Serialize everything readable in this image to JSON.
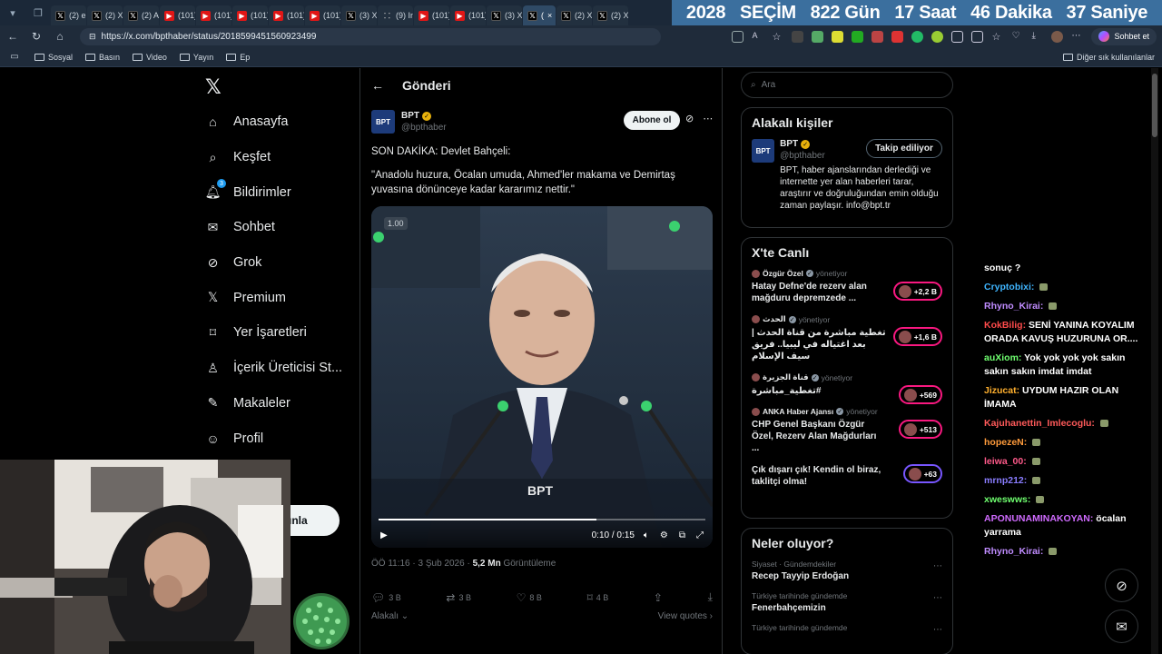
{
  "browser": {
    "tabs": [
      {
        "label": "(2) er",
        "icon": "x-icon"
      },
      {
        "label": "(2) X",
        "icon": "x-icon"
      },
      {
        "label": "(2) A",
        "icon": "x-icon"
      },
      {
        "label": "(101)",
        "icon": "youtube-icon"
      },
      {
        "label": "(101)",
        "icon": "youtube-icon"
      },
      {
        "label": "(101)",
        "icon": "youtube-icon"
      },
      {
        "label": "(101)",
        "icon": "youtube-icon"
      },
      {
        "label": "(101)",
        "icon": "youtube-icon"
      },
      {
        "label": "(3) X",
        "icon": "x-icon"
      },
      {
        "label": "(9) In",
        "icon": "grid-icon"
      },
      {
        "label": "(101)",
        "icon": "youtube-icon"
      },
      {
        "label": "(101)",
        "icon": "youtube-icon"
      },
      {
        "label": "(3) X",
        "icon": "x-icon"
      },
      {
        "label": "(",
        "icon": "x-icon",
        "active": true
      },
      {
        "label": "(2) X",
        "icon": "x-icon"
      },
      {
        "label": "(2) X",
        "icon": "x-icon"
      }
    ],
    "countdown": {
      "year": "2028",
      "label": "SEÇİM",
      "days": "822 Gün",
      "hours": "17 Saat",
      "minutes": "46 Dakika",
      "seconds": "37 Saniye"
    },
    "url": "https://x.com/bpthaber/status/2018599451560923499",
    "copilot_label": "Sohbet et",
    "bookmarks": [
      "Sosyal",
      "Basın",
      "Video",
      "Yayın",
      "Ep"
    ],
    "other_bookmarks": "Diğer sık kullanılanlar"
  },
  "nav": {
    "items": [
      {
        "label": "Anasayfa",
        "icon": "home-icon"
      },
      {
        "label": "Keşfet",
        "icon": "search-icon"
      },
      {
        "label": "Bildirimler",
        "icon": "bell-icon",
        "badge": "3"
      },
      {
        "label": "Sohbet",
        "icon": "mail-icon"
      },
      {
        "label": "Grok",
        "icon": "grok-icon"
      },
      {
        "label": "Premium",
        "icon": "x-icon"
      },
      {
        "label": "Yer İşaretleri",
        "icon": "bookmark-icon"
      },
      {
        "label": "İçerik Üreticisi St...",
        "icon": "creator-icon"
      },
      {
        "label": "Makaleler",
        "icon": "article-icon"
      },
      {
        "label": "Profil",
        "icon": "person-icon"
      }
    ],
    "partial_label": "a",
    "post_button_fragment": "ınla"
  },
  "main": {
    "header": "Gönderi",
    "author": {
      "name": "BPT",
      "handle": "@bpthaber",
      "avatar_text": "BPT"
    },
    "subscribe": "Abone ol",
    "text_lines": [
      "SON DAKİKA: Devlet Bahçeli:",
      "\"Anadolu huzura, Öcalan umuda, Ahmed'ler makama ve Demirtaş yuvasına dönünceye kadar kararımız nettir.\""
    ],
    "video": {
      "rate": "1.00",
      "time": "0:10 / 0:15",
      "progress": 0.667,
      "watermark": "BPT"
    },
    "meta": {
      "time": "ÖÖ 11:16 · 3 Şub 2026 · ",
      "views": "5,2 Mn",
      "views_label": " Görüntüleme"
    },
    "actions": {
      "replies": "3 B",
      "reposts": "3 B",
      "likes": "8 B",
      "bookmarks": "4 B"
    },
    "related_label": "Alakalı",
    "view_quotes": "View quotes"
  },
  "sidebar": {
    "search_placeholder": "Ara",
    "related": {
      "title": "Alakalı kişiler",
      "name": "BPT",
      "handle": "@bpthaber",
      "follow": "Takip ediliyor",
      "bio": "BPT, haber ajanslarından derlediği ve internette yer alan haberleri tarar, araştırır ve doğruluğundan emin olduğu zaman paylaşır. info@bpt.tr"
    },
    "live": {
      "title": "X'te Canlı",
      "items": [
        {
          "host": "Özgür Özel",
          "role": "yönetiyor",
          "title": "Hatay Defne'de rezerv alan mağduru depremzede ...",
          "count": "+2,2 B"
        },
        {
          "host": "الحدث",
          "role": "yönetiyor",
          "title": "تغطية مباشرة من قناة الحدث | بعد اغتياله في ليبيا.. فريق سيف الإسلام",
          "count": "+1,6 B"
        },
        {
          "host": "قناة الجزيرة",
          "role": "yönetiyor",
          "title": "#تغطية_مباشرة",
          "count": "+569"
        },
        {
          "host": "ANKA Haber Ajansı",
          "role": "yönetiyor",
          "title": "CHP Genel Başkanı Özgür Özel, Rezerv Alan Mağdurları ...",
          "count": "+513"
        },
        {
          "host": "",
          "role": "",
          "title": "Çık dışarı çık! Kendin ol biraz, taklitçi olma!",
          "count": "+63"
        }
      ]
    },
    "trends": {
      "title": "Neler oluyor?",
      "items": [
        {
          "category": "Siyaset · Gündemdekiler",
          "name": "Recep Tayyip Erdoğan"
        },
        {
          "category": "Türkiye tarihinde gündemde",
          "name": "Fenerbahçemizin"
        },
        {
          "category": "Türkiye tarihinde gündemde",
          "name": ""
        }
      ]
    }
  },
  "chat": [
    {
      "user": "",
      "message": "sonuç ?",
      "color": "#ffffff"
    },
    {
      "user": "Cryptobixi:",
      "message": "",
      "color": "#3fb5ff"
    },
    {
      "user": "Rhyno_Kirai:",
      "message": "",
      "color": "#c08cff"
    },
    {
      "user": "KokBilig:",
      "message": "SENİ YANINA KOYALIM ORADA KAVUŞ HUZURUNA OR....",
      "color": "#ff4b4b"
    },
    {
      "user": "auXiom:",
      "message": "Yok yok yok yok sakın sakın sakın imdat imdat",
      "color": "#6fff6f"
    },
    {
      "user": "Jizucat:",
      "message": "UYDUM HAZIR OLAN İMAMA",
      "color": "#ffb02e"
    },
    {
      "user": "Kajuhanettin_Imlecoglu:",
      "message": "",
      "color": "#ff5a5a"
    },
    {
      "user": "hopezeN:",
      "message": "",
      "color": "#ff9b3b"
    },
    {
      "user": "leiwa_00:",
      "message": "",
      "color": "#ff5a8a"
    },
    {
      "user": "mrnp212:",
      "message": "",
      "color": "#8a7dff"
    },
    {
      "user": "xweswws:",
      "message": "",
      "color": "#6fff6f"
    },
    {
      "user": "APONUNAMINAKOYAN:",
      "message": "öcalan yarrama",
      "color": "#d06bff"
    },
    {
      "user": "Rhyno_Kirai:",
      "message": "",
      "color": "#c08cff"
    }
  ]
}
